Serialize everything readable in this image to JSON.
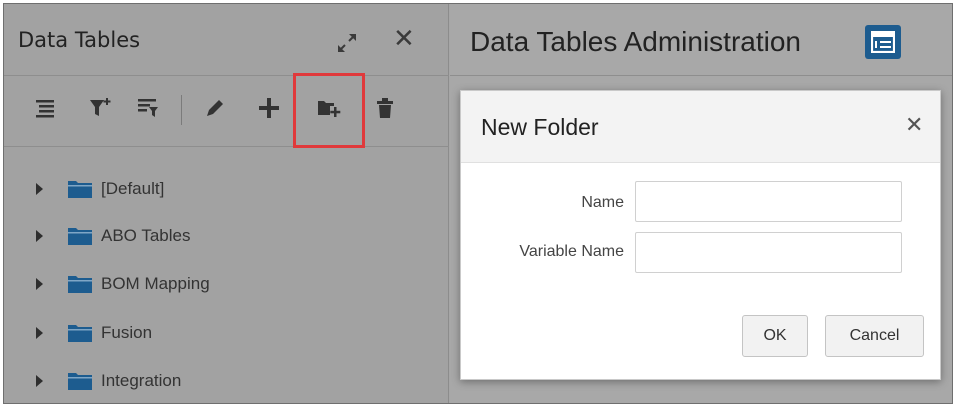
{
  "left_panel": {
    "title": "Data Tables",
    "toolbar": {
      "items": [
        "list-icon",
        "filter-add-icon",
        "filter-edit-icon",
        "pencil-icon",
        "plus-icon",
        "new-folder-icon",
        "trash-icon"
      ],
      "highlighted": "new-folder-icon",
      "highlight_color": "#e0393b"
    },
    "tree": [
      {
        "label": "[Default]"
      },
      {
        "label": "ABO Tables"
      },
      {
        "label": "BOM Mapping"
      },
      {
        "label": "Fusion"
      },
      {
        "label": "Integration"
      }
    ]
  },
  "right_panel": {
    "title": "Data Tables Administration",
    "icon": "table-admin-icon",
    "icon_color": "#1d5c8f"
  },
  "dialog": {
    "title": "New Folder",
    "fields": [
      {
        "label": "Name",
        "value": "",
        "placeholder": ""
      },
      {
        "label": "Variable Name",
        "value": "",
        "placeholder": ""
      }
    ],
    "ok_label": "OK",
    "cancel_label": "Cancel"
  },
  "colors": {
    "folder": "#1d5c8f",
    "overlay": "#a6a6a6"
  }
}
